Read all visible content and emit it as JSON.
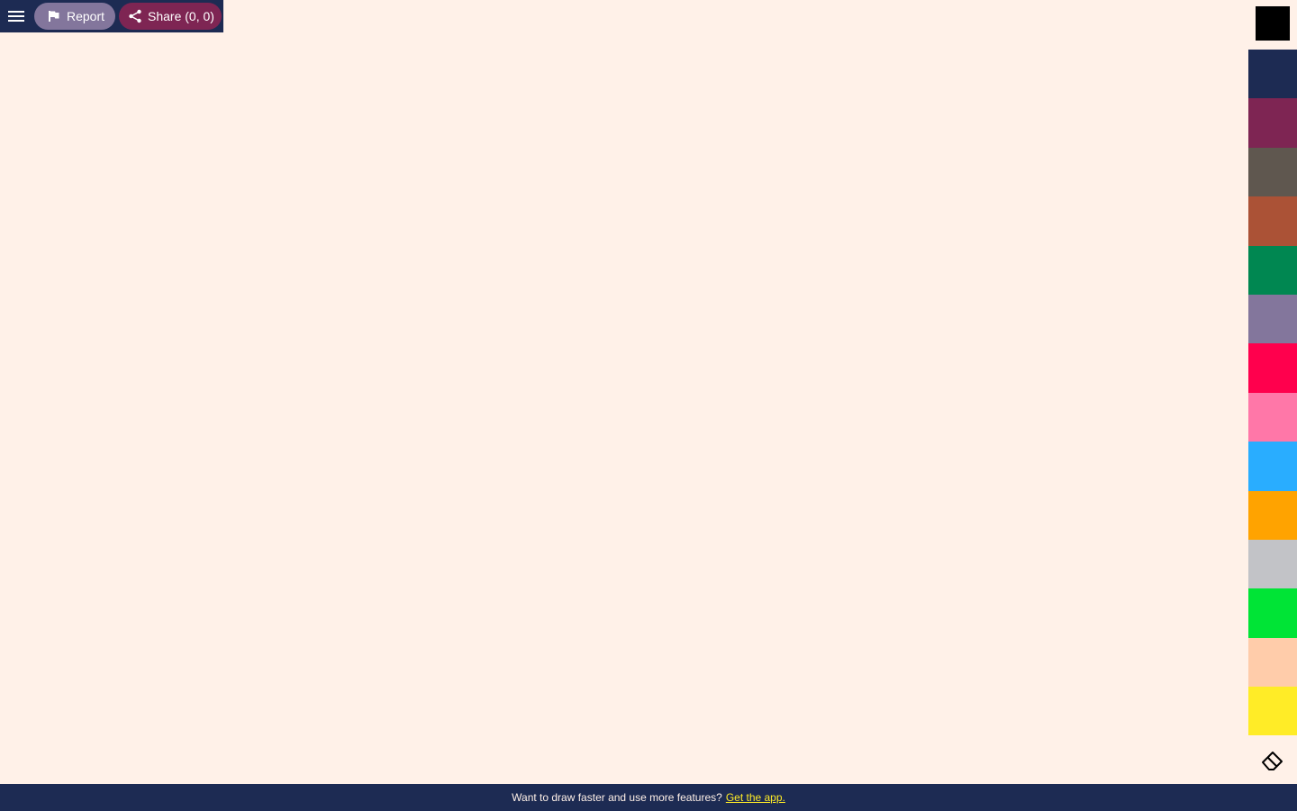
{
  "toolbar": {
    "menu_icon": "hamburger-menu-icon",
    "report_label": "Report",
    "report_icon": "flag-icon",
    "share_label": "Share (0, 0)",
    "share_icon": "share-icon"
  },
  "palette": {
    "current_color": "#000000",
    "colors": [
      "#1d2b53",
      "#7e2553",
      "#5f574f",
      "#ab5236",
      "#008751",
      "#83769c",
      "#ff004d",
      "#ff77a8",
      "#29adff",
      "#ffa300",
      "#c2c3c7",
      "#00e436",
      "#ffccaa",
      "#ffec27"
    ],
    "eraser_icon": "eraser-icon"
  },
  "footer": {
    "text": "Want to draw faster and use more features?",
    "link_text": "Get the app."
  },
  "theme": {
    "canvas_bg": "#fff1e8",
    "bar_bg": "#1d2b53",
    "link_color": "#ffec27"
  }
}
